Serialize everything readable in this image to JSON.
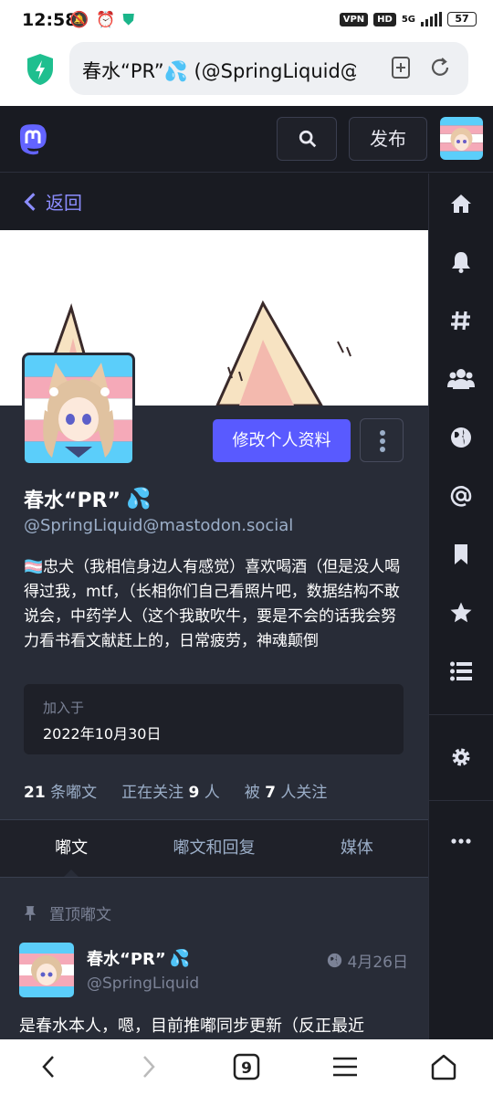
{
  "status_bar": {
    "time": "12:58",
    "vpn": "VPN",
    "hd": "HD",
    "network": "5G",
    "battery": "57"
  },
  "browser": {
    "url_text": "春水“PR”💦 (@SpringLiquid@"
  },
  "nav": {
    "publish_label": "发布"
  },
  "profile": {
    "back_label": "返回",
    "edit_label": "修改个人资料",
    "display_name": "春水“PR”",
    "handle": "@SpringLiquid@mastodon.social",
    "bio": "🏳️‍⚧️忠犬（我相信身边人有感觉）喜欢喝酒（但是没人喝得过我，mtf，（长相你们自己看照片吧，数据结构不敢说会，中药学人（这个我敢吹牛，要是不会的话我会努力看书看文献赶上的，日常疲劳，神魂颠倒",
    "joined_label": "加入于",
    "joined_date": "2022年10月30日",
    "stats": {
      "posts_count": "21",
      "posts_label": "条嘟文",
      "following_prefix": "正在关注",
      "following_count": "9",
      "following_suffix": "人",
      "followers_prefix": "被",
      "followers_count": "7",
      "followers_suffix": "人关注"
    }
  },
  "tabs": [
    {
      "label": "嘟文"
    },
    {
      "label": "嘟文和回复"
    },
    {
      "label": "媒体"
    }
  ],
  "pinned_label": "置顶嘟文",
  "post": {
    "name": "春水“PR”",
    "handle": "@SpringLiquid",
    "date": "4月26日",
    "text": "是春水本人，嗯，目前推嘟同步更新（反正最近"
  },
  "colors": {
    "accent": "#595aff",
    "link": "#8c8dff",
    "bg_dark": "#191b22",
    "bg_main": "#282c37"
  }
}
